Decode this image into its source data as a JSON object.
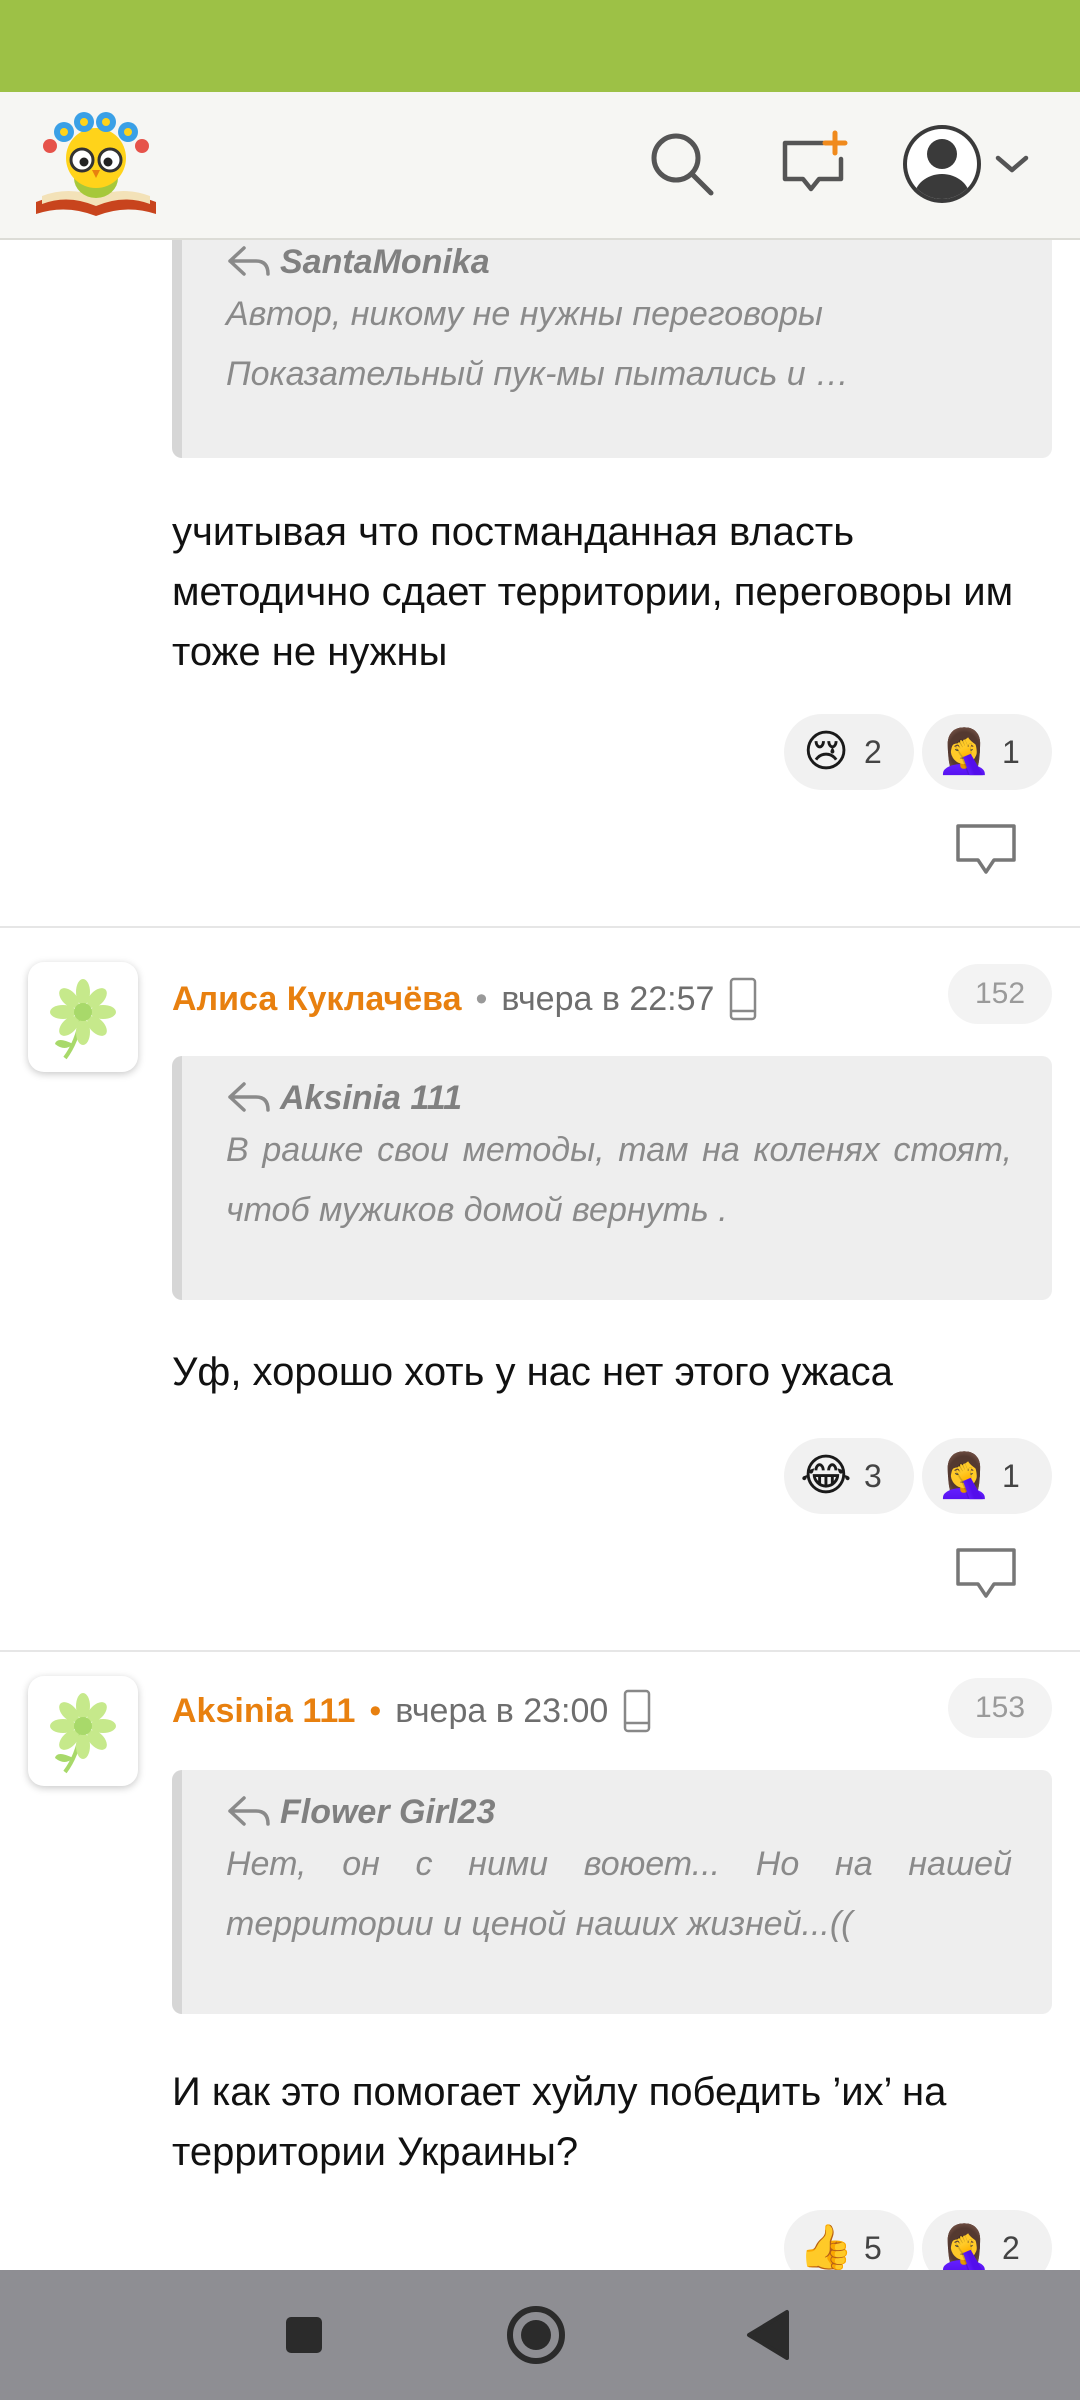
{
  "header": {
    "logo_icon": "reading-owl-logo",
    "search_icon": "search-icon",
    "new_message_icon": "new-message-icon",
    "account_icon": "user-avatar-icon"
  },
  "comments": [
    {
      "quote": {
        "author": "SantaMonika",
        "text": "Автор, никому не нужны переговоры\nПоказательный пук-мы пытались и …"
      },
      "text": "учитывая что постманданная власть методично сдает территории, переговоры им тоже не нужны",
      "reactions": [
        {
          "emoji": "😢",
          "count": "2"
        },
        {
          "emoji": "🤦‍♀️",
          "count": "1"
        }
      ]
    },
    {
      "author": "Алиса Куклачёва",
      "separator": "•",
      "time": "вчера в 22:57",
      "number": "152",
      "quote": {
        "author": "Aksinia 111",
        "text": "В рашке свои методы, там на коленях стоят, чтоб мужиков домой вернуть ."
      },
      "text": "Уф, хорошо хоть у нас нет этого ужаса",
      "reactions": [
        {
          "emoji": "😂",
          "count": "3"
        },
        {
          "emoji": "🤦‍♀️",
          "count": "1"
        }
      ]
    },
    {
      "author": "Aksinia 111",
      "separator": "•",
      "time": "вчера в 23:00",
      "number": "153",
      "quote": {
        "author": "Flower Girl23",
        "text": "Нет, он с ними воюет... Но на нашей территории и ценой наших жизней...(("
      },
      "text": "И как это помогает хуйлу победить ’их’ на территории Украины?",
      "reactions": [
        {
          "emoji": "👍",
          "count": "5"
        },
        {
          "emoji": "🤦‍♀️",
          "count": "2"
        }
      ]
    }
  ],
  "colors": {
    "status_bar": "#9dc146",
    "author_accent": "#e8800f",
    "nav_bar": "#8e8e93"
  }
}
